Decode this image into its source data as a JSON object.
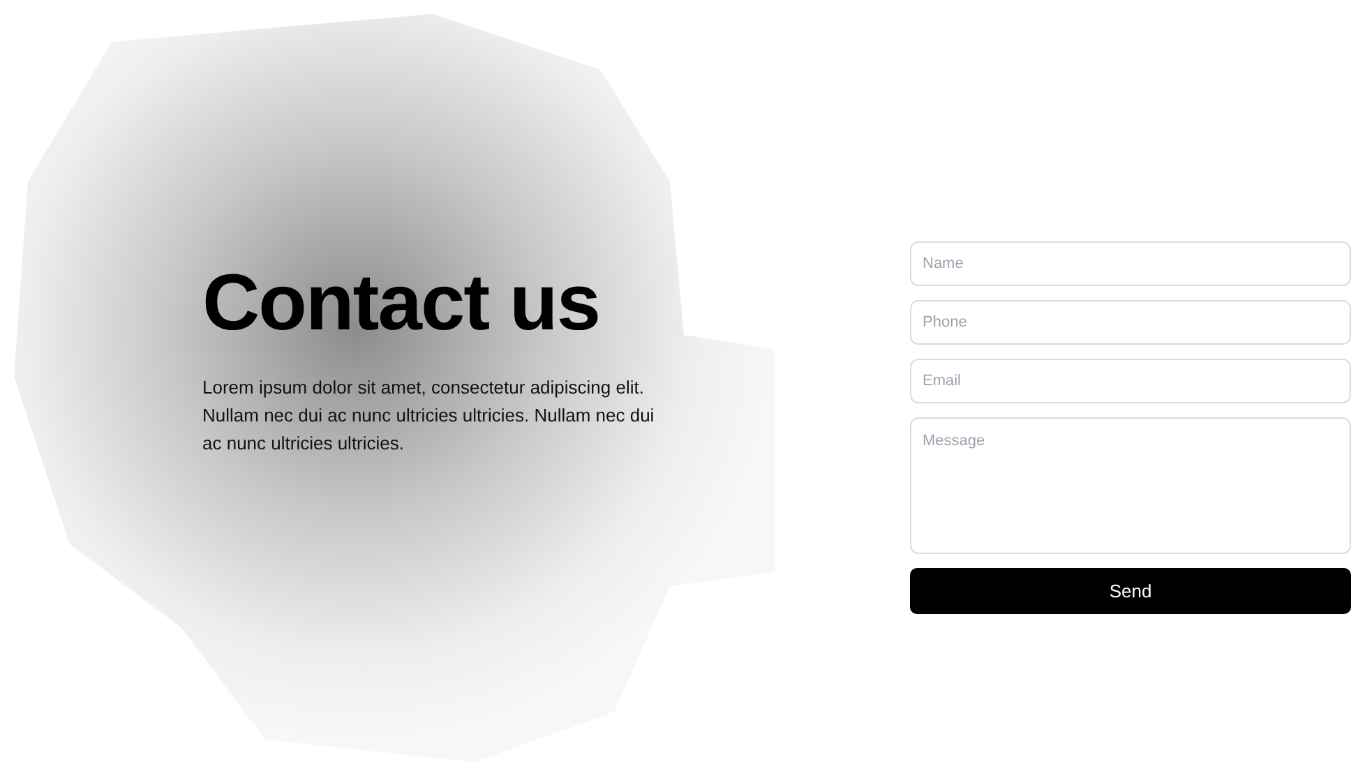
{
  "heading": "Contact us",
  "intro": "Lorem ipsum dolor sit amet, consectetur adipiscing elit. Nullam nec dui ac nunc ultricies ultricies. Nullam nec dui ac nunc ultricies ultricies.",
  "form": {
    "fields": [
      {
        "kind": "line",
        "placeholder": "Name"
      },
      {
        "kind": "line",
        "placeholder": "Phone"
      },
      {
        "kind": "line",
        "placeholder": "Email"
      },
      {
        "kind": "area",
        "placeholder": "Message"
      }
    ],
    "submit": "Send"
  }
}
